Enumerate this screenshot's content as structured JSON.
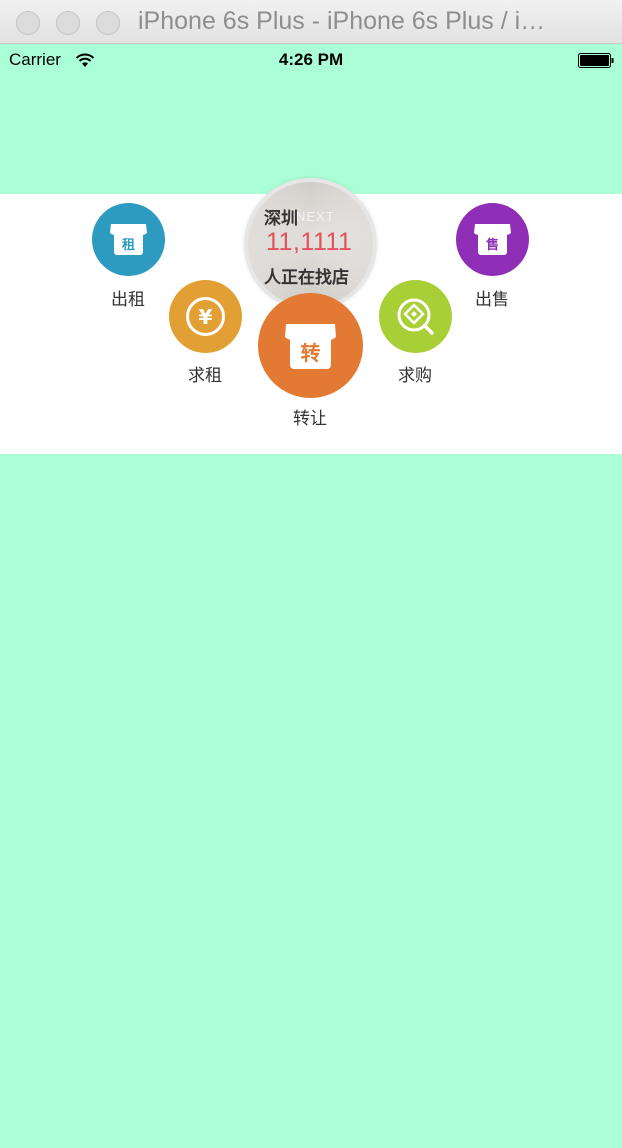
{
  "window": {
    "title": "iPhone 6s Plus - iPhone 6s Plus / i…"
  },
  "statusbar": {
    "carrier": "Carrier",
    "time": "4:26 PM"
  },
  "banner": {
    "city": "深圳",
    "count": "11,1111",
    "caption": "人正在找店",
    "bg_sign": "NEXT"
  },
  "actions": {
    "rent_out": {
      "label": "出租",
      "glyph": "租",
      "color": "#2d9ac0",
      "icon": "shop-icon"
    },
    "sell": {
      "label": "出售",
      "glyph": "售",
      "color": "#8f2fb8",
      "icon": "shop-icon"
    },
    "seek_rent": {
      "label": "求租",
      "glyph": "¥",
      "color": "#e2a034",
      "icon": "yen-circle-icon"
    },
    "seek_buy": {
      "label": "求购",
      "color": "#a9cf37",
      "icon": "diamond-search-icon"
    },
    "transfer": {
      "label": "转让",
      "glyph": "转",
      "color": "#e27a33",
      "icon": "shop-icon"
    }
  },
  "colors": {
    "screen_bg": "#aaffd6",
    "panel_bg": "#ffffff",
    "count_color": "#e2525b"
  }
}
